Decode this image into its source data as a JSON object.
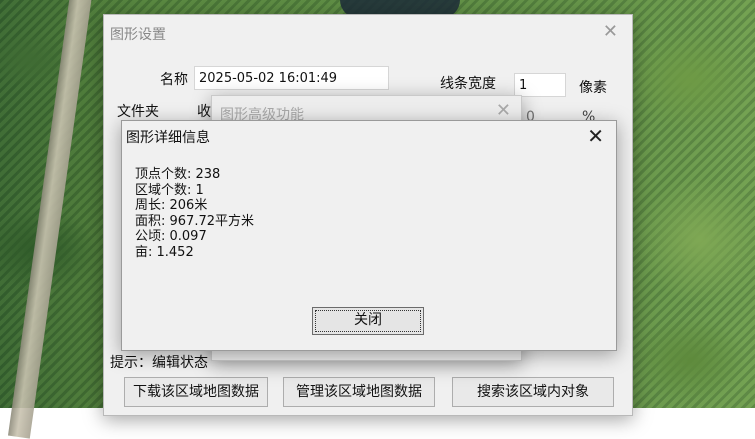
{
  "settings": {
    "title": "图形设置",
    "close_glyph": "✕",
    "name_label": "名称",
    "name_value": "2025-05-02 16:01:49",
    "line_width_label": "线条宽度",
    "line_width_value": "1",
    "unit_pixel": "像素",
    "folder_label": "文件夹",
    "folder_value_partial": "收",
    "opacity_value_partial": "0",
    "percent": "%",
    "hint_label": "提示：编辑状态",
    "buttons": {
      "download": "下载该区域地图数据",
      "manage": "管理该区域地图数据",
      "search": "搜索该区域内对象"
    }
  },
  "advanced": {
    "title": "图形高级功能",
    "close_glyph": "✕"
  },
  "details": {
    "title": "图形详细信息",
    "close_glyph": "✕",
    "lines": [
      "顶点个数: 238",
      "区域个数: 1",
      "周长: 206米",
      "面积: 967.72平方米",
      "公顷: 0.097",
      "亩: 1.452"
    ],
    "close_button": "关闭"
  }
}
